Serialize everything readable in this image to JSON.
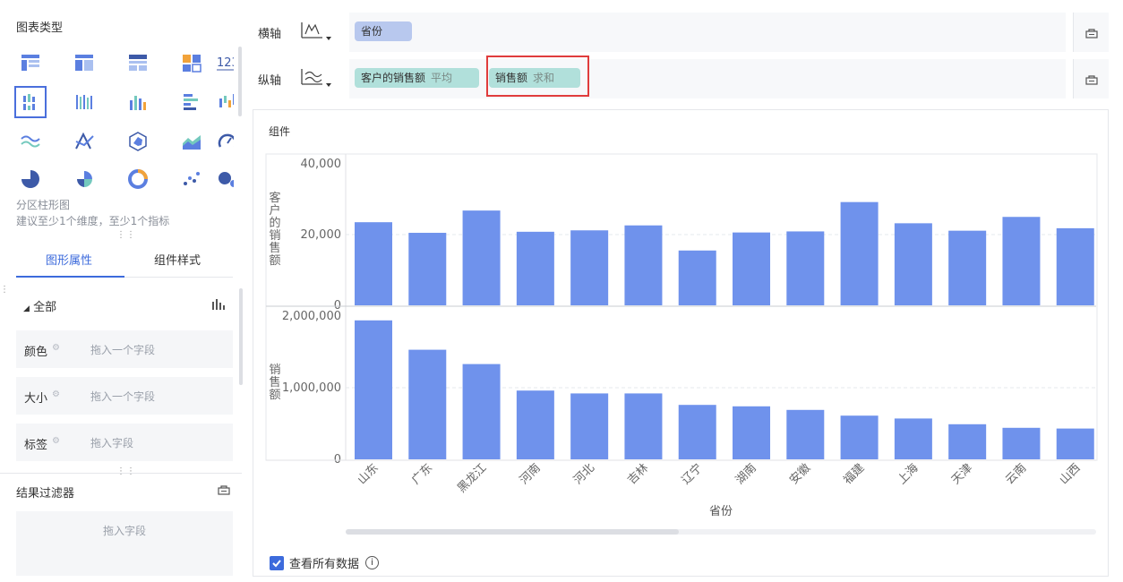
{
  "left_panel": {
    "chart_type_title": "图表类型",
    "selected_type_name": "分区柱形图",
    "selected_type_hint": "建议至少1个维度，至少1个指标",
    "chart_type_icons": [
      "table-icon",
      "cross-table-icon",
      "detail-table-icon",
      "kpi-grid-icon",
      "number-123-icon",
      "grouped-bar-icon",
      "multi-bar-icon",
      "column-icon",
      "horizontal-bar-icon",
      "waterfall-icon",
      "wave-line-icon",
      "radar-line-icon",
      "hexagon-icon",
      "area-icon",
      "gauge-icon",
      "pie-icon",
      "rose-pie-icon",
      "ring-icon",
      "scatter-icon",
      "bubble-icon"
    ],
    "tabs": {
      "graph_props": "图形属性",
      "component_style": "组件样式"
    },
    "all_label": "全部",
    "props": [
      {
        "label": "颜色",
        "placeholder": "拖入一个字段"
      },
      {
        "label": "大小",
        "placeholder": "拖入一个字段"
      },
      {
        "label": "标签",
        "placeholder": "拖入字段"
      }
    ],
    "filter": {
      "title": "结果过滤器",
      "placeholder": "拖入字段"
    }
  },
  "x_axis": {
    "label": "横轴",
    "field": "省份"
  },
  "y_axis": {
    "label": "纵轴",
    "fields": [
      {
        "name": "客户的销售额",
        "agg": "平均"
      },
      {
        "name": "销售额",
        "agg": "求和"
      }
    ]
  },
  "chart_panel": {
    "component_title": "组件",
    "view_all_label": "查看所有数据"
  },
  "chart_data": {
    "type": "bar",
    "x_label": "省份",
    "categories": [
      "山东",
      "广东",
      "黑龙江",
      "河南",
      "河北",
      "吉林",
      "辽宁",
      "湖南",
      "安徽",
      "福建",
      "上海",
      "天津",
      "云南",
      "山西"
    ],
    "bar_color": "#6f92ec",
    "series": [
      {
        "y_label": "客户的销售额",
        "ylim": [
          0,
          40000
        ],
        "ticks": [
          "40,000",
          "20,000",
          "0"
        ],
        "values": [
          23500,
          20500,
          26800,
          20800,
          21200,
          22600,
          15500,
          20600,
          20900,
          29200,
          23200,
          21100,
          25000,
          21800
        ]
      },
      {
        "y_label": "销售额",
        "ylim": [
          0,
          2000000
        ],
        "ticks": [
          "2,000,000",
          "1,000,000",
          "0"
        ],
        "values": [
          1940000,
          1530000,
          1330000,
          960000,
          920000,
          920000,
          760000,
          740000,
          690000,
          610000,
          570000,
          490000,
          440000,
          430000
        ]
      }
    ]
  }
}
